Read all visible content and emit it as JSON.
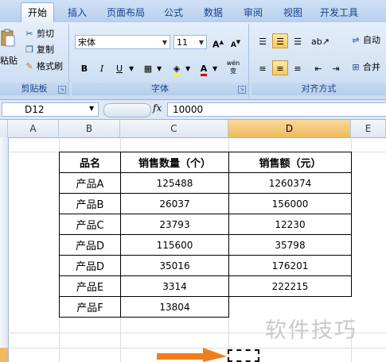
{
  "ribbon": {
    "tabs": [
      {
        "label": "开始",
        "active": true
      },
      {
        "label": "插入",
        "active": false
      },
      {
        "label": "页面布局",
        "active": false
      },
      {
        "label": "公式",
        "active": false
      },
      {
        "label": "数据",
        "active": false
      },
      {
        "label": "审阅",
        "active": false
      },
      {
        "label": "视图",
        "active": false
      },
      {
        "label": "开发工具",
        "active": false
      }
    ],
    "clipboard": {
      "paste_label": "粘贴",
      "cut_label": "剪切",
      "copy_label": "复制",
      "format_painter_label": "格式刷",
      "group_label": "剪贴板"
    },
    "font": {
      "font_name": "宋体",
      "font_size": "11",
      "grow_label": "A",
      "shrink_label": "A",
      "bold_label": "B",
      "italic_label": "I",
      "underline_label": "U",
      "font_color_label": "A",
      "phonetic_label": "wén 变",
      "group_label": "字体"
    },
    "alignment": {
      "wrap_label": "自动",
      "merge_label": "合并",
      "group_label": "对齐方式"
    }
  },
  "formula_bar": {
    "name_box": "D12",
    "fx_label": "fx",
    "value": "10000"
  },
  "sheet": {
    "columns": [
      "A",
      "B",
      "C",
      "D",
      "E"
    ],
    "selected_column": "D"
  },
  "table": {
    "headers": [
      "品名",
      "销售数量（个）",
      "销售额（元）"
    ],
    "rows": [
      [
        "产品A",
        "125488",
        "1260374"
      ],
      [
        "产品B",
        "26037",
        "156000"
      ],
      [
        "产品C",
        "23793",
        "12230"
      ],
      [
        "产品D",
        "115600",
        "35798"
      ],
      [
        "产品D",
        "35016",
        "176201"
      ],
      [
        "产品E",
        "3314",
        "222215"
      ],
      [
        "产品F",
        "13804",
        ""
      ]
    ]
  },
  "watermark": "软件技巧",
  "colors": {
    "ribbon_accent": "#15428b",
    "selected_header": "#f1b95a",
    "arrow": "#f07d1c"
  }
}
